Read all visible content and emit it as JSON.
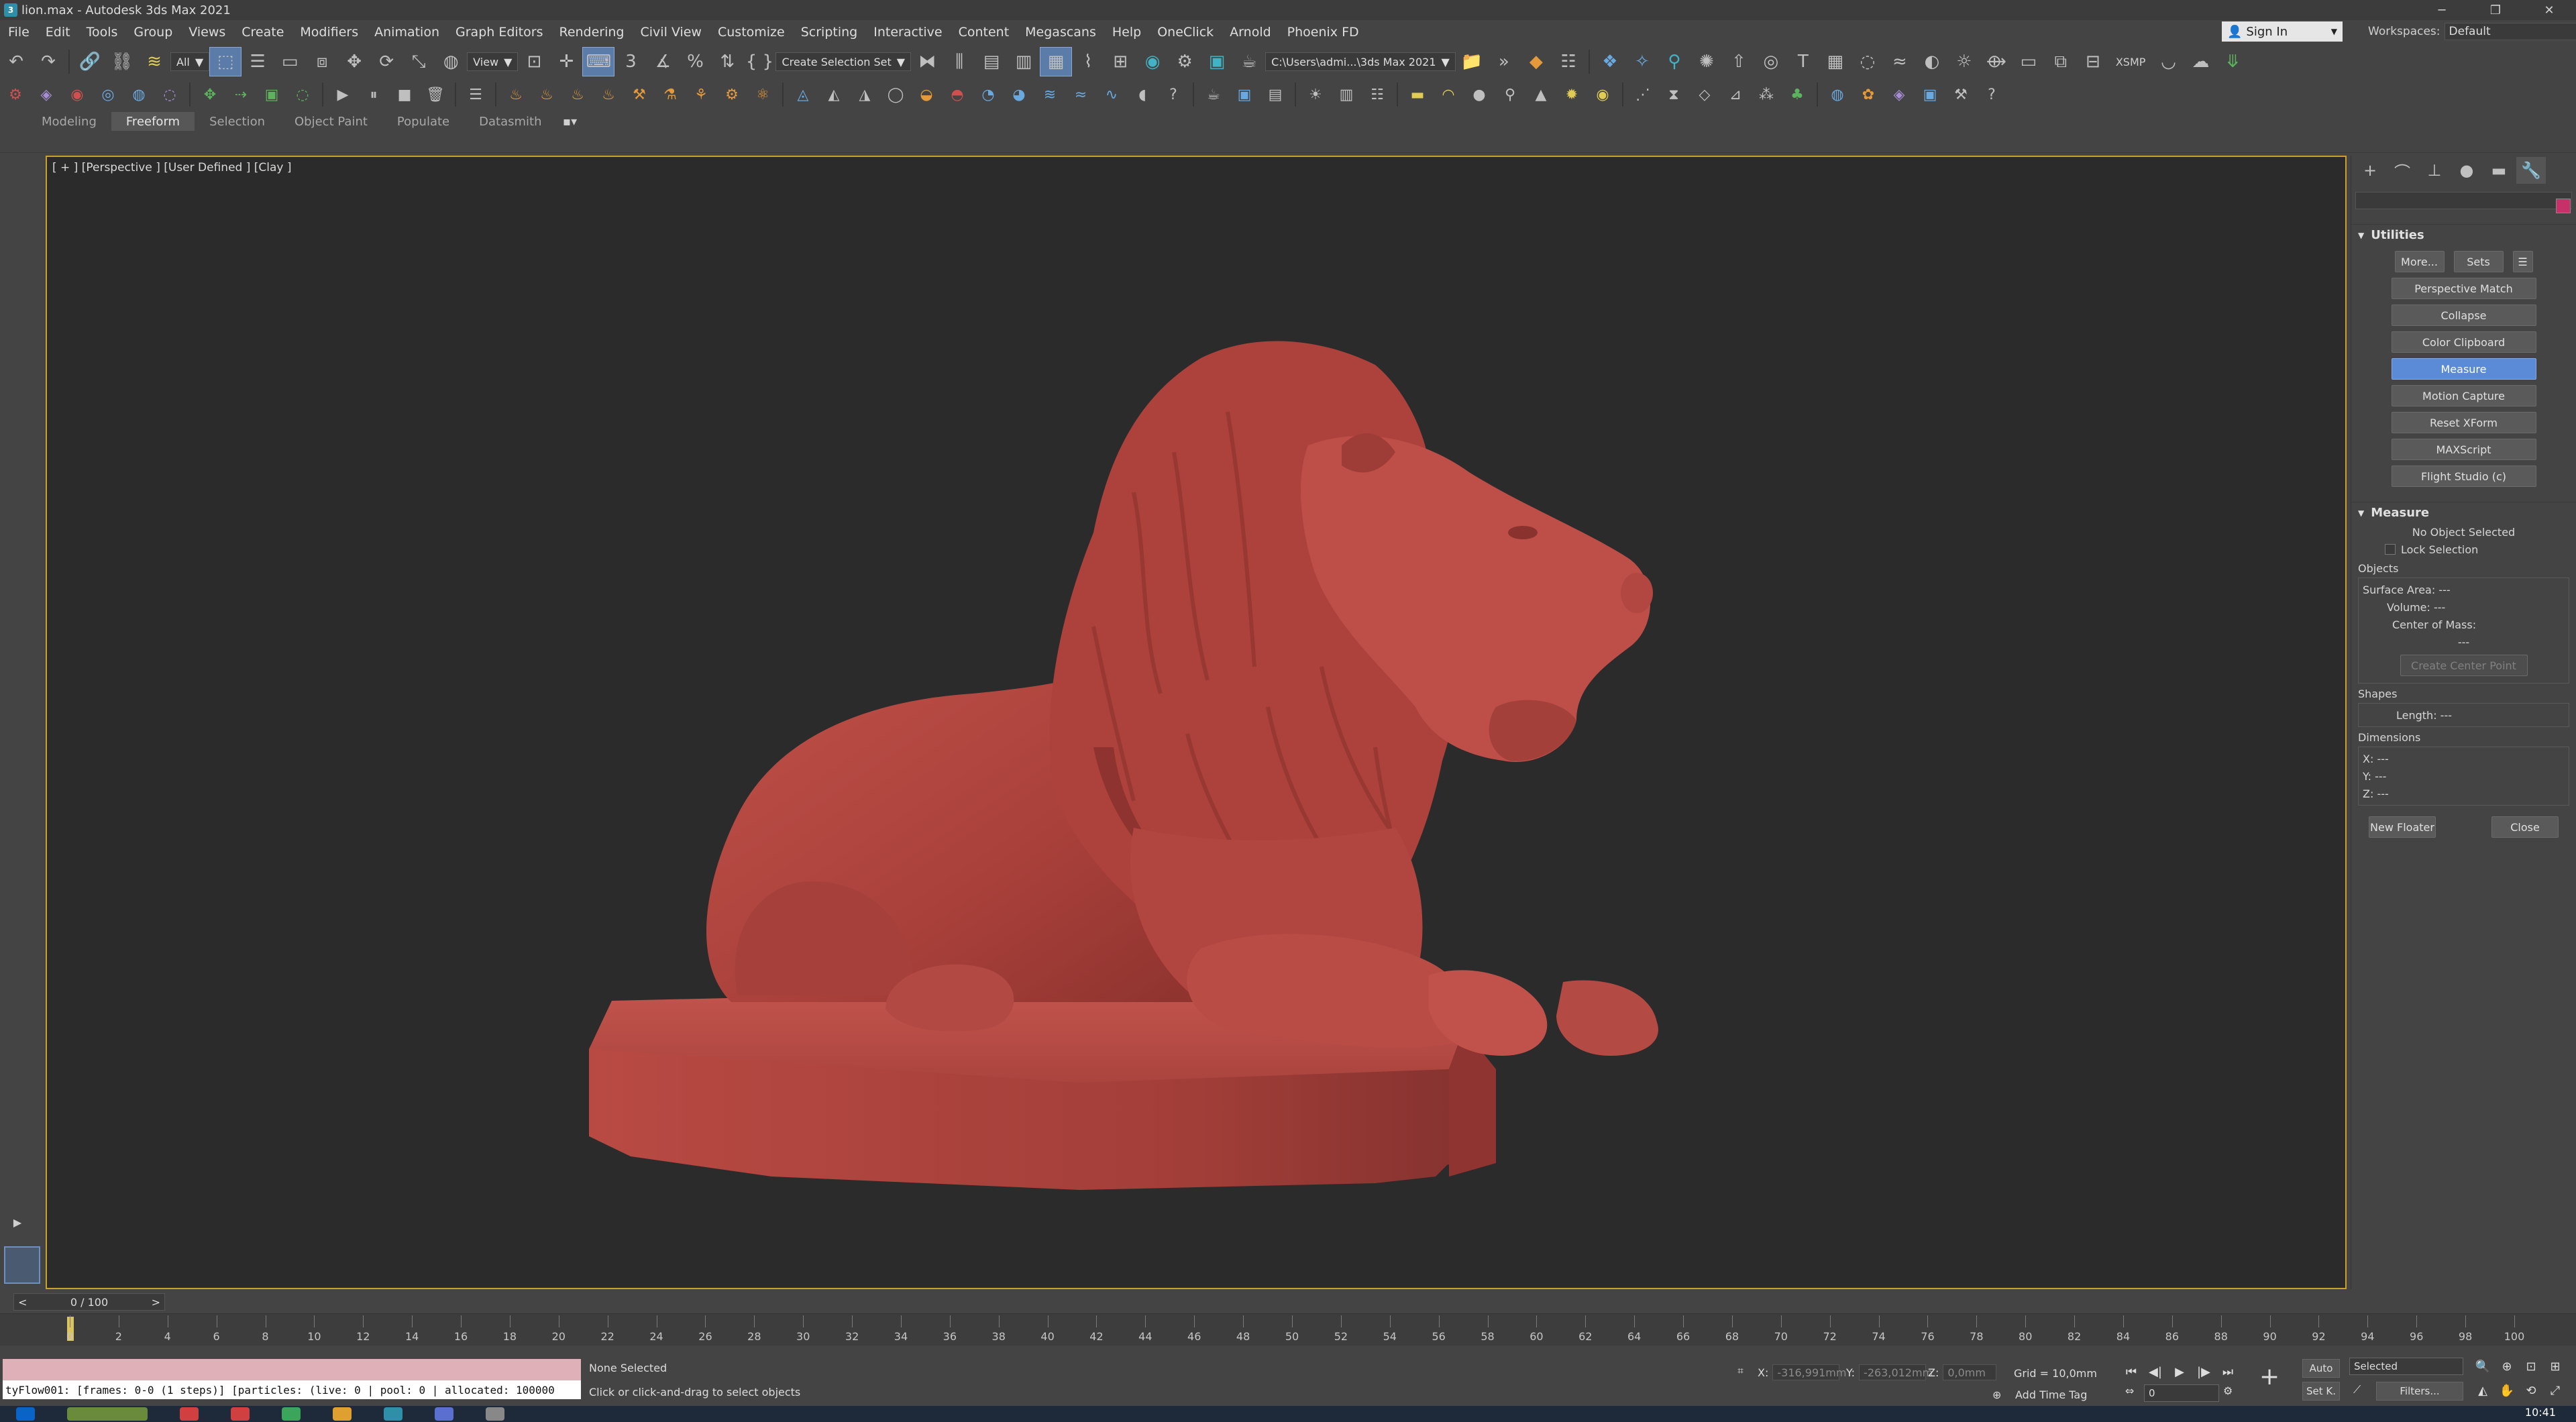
{
  "window": {
    "title": "lion.max - Autodesk 3ds Max 2021",
    "app_icon": "3ds-max-icon",
    "controls": [
      "─",
      "❐",
      "✕"
    ]
  },
  "menubar": {
    "items": [
      "File",
      "Edit",
      "Tools",
      "Group",
      "Views",
      "Create",
      "Modifiers",
      "Animation",
      "Graph Editors",
      "Rendering",
      "Civil View",
      "Customize",
      "Scripting",
      "Interactive",
      "Content",
      "Megascans",
      "Help",
      "OneClick",
      "Arnold",
      "Phoenix FD"
    ],
    "sign_in": "Sign In",
    "workspaces_label": "Workspaces:",
    "workspace_value": "Default"
  },
  "toolbar1": {
    "selection_filter": "All",
    "ref_coord": "View",
    "selection_set": "Create Selection Set",
    "project_path": "C:\\Users\\admi...\\3ds Max 2021",
    "xsmp": "XSMP"
  },
  "ribbon": {
    "tabs": [
      "Modeling",
      "Freeform",
      "Selection",
      "Object Paint",
      "Populate",
      "Datasmith"
    ],
    "active_tab": "Freeform"
  },
  "viewport": {
    "label": "[ + ] [Perspective ] [User Defined ] [Clay ]",
    "model_color": "#b1433e",
    "background": "#2b2b2b",
    "border_color": "#c9a227"
  },
  "command_panel": {
    "utilities_title": "Utilities",
    "more_label": "More...",
    "sets_label": "Sets",
    "utility_buttons": [
      "Perspective Match",
      "Collapse",
      "Color Clipboard",
      "Measure",
      "Motion Capture",
      "Reset XForm",
      "MAXScript",
      "Flight Studio (c)"
    ],
    "active_utility": "Measure",
    "measure": {
      "title": "Measure",
      "status": "No Object Selected",
      "lock_selection": "Lock Selection",
      "objects_label": "Objects",
      "surface_area": "Surface Area:  ---",
      "volume": "Volume:  ---",
      "center_of_mass": "Center of Mass:",
      "center_value": "---",
      "create_center_point": "Create Center Point",
      "shapes_label": "Shapes",
      "length": "Length:  ---",
      "dimensions_label": "Dimensions",
      "x": "X:  ---",
      "y": "Y:  ---",
      "z": "Z:  ---",
      "new_floater": "New Floater",
      "close": "Close"
    }
  },
  "timeline": {
    "frame_display": "0 / 100",
    "ticks": [
      0,
      2,
      4,
      6,
      8,
      10,
      12,
      14,
      16,
      18,
      20,
      22,
      24,
      26,
      28,
      30,
      32,
      34,
      36,
      38,
      40,
      42,
      44,
      46,
      48,
      50,
      52,
      54,
      56,
      58,
      60,
      62,
      64,
      66,
      68,
      70,
      72,
      74,
      76,
      78,
      80,
      82,
      84,
      86,
      88,
      90,
      92,
      94,
      96,
      98,
      100
    ]
  },
  "statusbar": {
    "maxscript_output": "tyFlow001: [frames: 0-0 (1 steps)] [particles: (live: 0 | pool: 0 | allocated: 100000",
    "selection_status": "None Selected",
    "prompt": "Click or click-and-drag to select objects",
    "x_label": "X:",
    "x_value": "-316,991mm",
    "y_label": "Y:",
    "y_value": "-263,012mm",
    "z_label": "Z:",
    "z_value": "0,0mm",
    "grid": "Grid = 10,0mm",
    "add_time_tag": "Add Time Tag",
    "auto_key": "Auto",
    "set_key": "Set K.",
    "selected_value": "Selected",
    "filters": "Filters...",
    "frame_value": "0"
  },
  "taskbar": {
    "clock": "10:41"
  }
}
